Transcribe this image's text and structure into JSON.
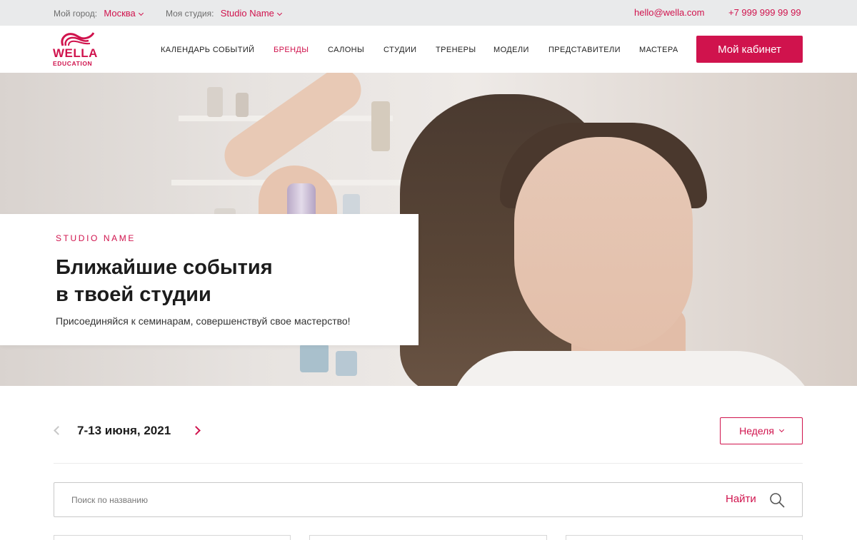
{
  "topbar": {
    "city_label": "Мой город:",
    "city_value": "Москва",
    "studio_label": "Моя студия:",
    "studio_value": "Studio Name",
    "email": "hello@wella.com",
    "phone": "+7 999 999 99 99"
  },
  "header": {
    "logo_word": "WELLA",
    "logo_sub": "EDUCATION",
    "nav": [
      {
        "label": "КАЛЕНДАРЬ СОБЫТИЙ",
        "active": false
      },
      {
        "label": "БРЕНДЫ",
        "active": true
      },
      {
        "label": "САЛОНЫ",
        "active": false
      },
      {
        "label": "СТУДИИ",
        "active": false
      },
      {
        "label": "ТРЕНЕРЫ",
        "active": false
      },
      {
        "label": "МОДЕЛИ",
        "active": false
      },
      {
        "label": "ПРЕДСТАВИТЕЛИ",
        "active": false
      },
      {
        "label": "МАСТЕРА",
        "active": false
      }
    ],
    "cabinet_button": "Мой кабинет"
  },
  "hero": {
    "label": "STUDIO NAME",
    "title_line1": "Ближайшие события",
    "title_line2": "в твоей студии",
    "subtitle": "Присоединяйся к семинарам, совершенствуй свое мастерство!"
  },
  "week": {
    "range": "7-13 июня, 2021",
    "period": "Неделя"
  },
  "search": {
    "placeholder": "Поиск по названию",
    "button": "Найти"
  },
  "colors": {
    "accent": "#d0134d",
    "topbar_bg": "#e9eaeb"
  }
}
